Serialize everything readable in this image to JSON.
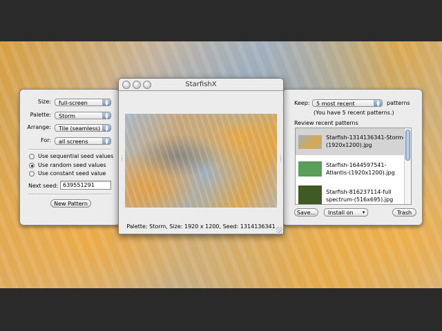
{
  "window": {
    "title": "StarfishX"
  },
  "left_panel": {
    "size_label": "Size:",
    "size_value": "full-screen",
    "palette_label": "Palette:",
    "palette_value": "Storm",
    "arrange_label": "Arrange:",
    "arrange_value": "Tile (seamless)",
    "for_label": "For:",
    "for_value": "all screens",
    "seed_options": [
      {
        "label": "Use sequential seed values",
        "selected": false
      },
      {
        "label": "Use random seed values",
        "selected": true
      },
      {
        "label": "Use constant seed value",
        "selected": false
      }
    ],
    "next_seed_label": "Next seed:",
    "next_seed_value": "639551291",
    "new_pattern_button": "New Pattern"
  },
  "preview": {
    "caption": "Palette: Storm, Size: 1920 x 1200, Seed: 1314136341"
  },
  "right_panel": {
    "keep_label": "Keep:",
    "keep_value": "5 most recent",
    "keep_suffix": "patterns",
    "recent_count_note": "(You have 5 recent patterns.)",
    "review_label": "Review recent patterns",
    "patterns": [
      {
        "name": "Starfish-1314136341-Storm-(1920x1200).jpg",
        "thumb_color": "#b4a48a",
        "selected": true
      },
      {
        "name": "Starfish-1644597541-Atlantis-(1920x1200).jpg",
        "thumb_color": "#5a9e5c",
        "selected": false
      },
      {
        "name": "Starfish-816237114-full spectrum-(516x695).jpg",
        "thumb_color": "#3f5a24",
        "selected": false
      }
    ],
    "save_button": "Save...",
    "install_value": "Install on",
    "trash_button": "Trash"
  },
  "colors": {
    "selection": "#d4d4d4",
    "accent": "#6f98cf"
  }
}
